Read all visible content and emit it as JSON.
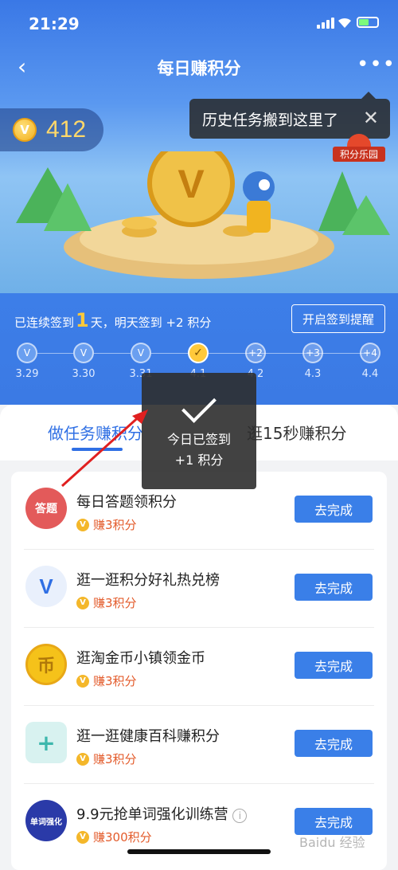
{
  "status": {
    "time": "21:29"
  },
  "nav": {
    "title": "每日赚积分"
  },
  "points": {
    "value": "412",
    "coin_glyph": "V"
  },
  "tip": {
    "text": "历史任务搬到这里了"
  },
  "park": {
    "label": "积分乐园"
  },
  "checkin": {
    "streak_prefix": "已连续签到",
    "streak_days": "1",
    "streak_suffix": "天，明天签到 +2 积分",
    "remind_button": "开启签到提醒",
    "days": [
      {
        "mark": "V",
        "label": "3.29"
      },
      {
        "mark": "V",
        "label": "3.30"
      },
      {
        "mark": "V",
        "label": "3.31"
      },
      {
        "mark": "✓",
        "label": "4.1"
      },
      {
        "mark": "+2",
        "label": "4.2"
      },
      {
        "mark": "+3",
        "label": "4.3"
      },
      {
        "mark": "+4",
        "label": "4.4"
      }
    ]
  },
  "tabs": [
    {
      "label": "做任务赚积分"
    },
    {
      "label": "逛15秒赚积分"
    }
  ],
  "tasks": [
    {
      "name": "每日答题领积分",
      "reward": "赚3积分",
      "button": "去完成",
      "icon": "quiz-icon",
      "icon_text": "答题"
    },
    {
      "name": "逛一逛积分好礼热兑榜",
      "reward": "赚3积分",
      "button": "去完成",
      "icon": "v-mascot-icon",
      "icon_text": "V"
    },
    {
      "name": "逛淘金币小镇领金币",
      "reward": "赚3积分",
      "button": "去完成",
      "icon": "gold-coin-icon",
      "icon_text": "币"
    },
    {
      "name": "逛一逛健康百科赚积分",
      "reward": "赚3积分",
      "button": "去完成",
      "icon": "health-box-icon",
      "icon_text": "+"
    },
    {
      "name": "9.9元抢单词强化训练营",
      "reward": "赚300积分",
      "button": "去完成",
      "icon": "vocab-camp-icon",
      "icon_text": "单词强化"
    }
  ],
  "toast": {
    "line1": "今日已签到",
    "line2": "+1 积分"
  },
  "watermark": "Baidu 经验"
}
